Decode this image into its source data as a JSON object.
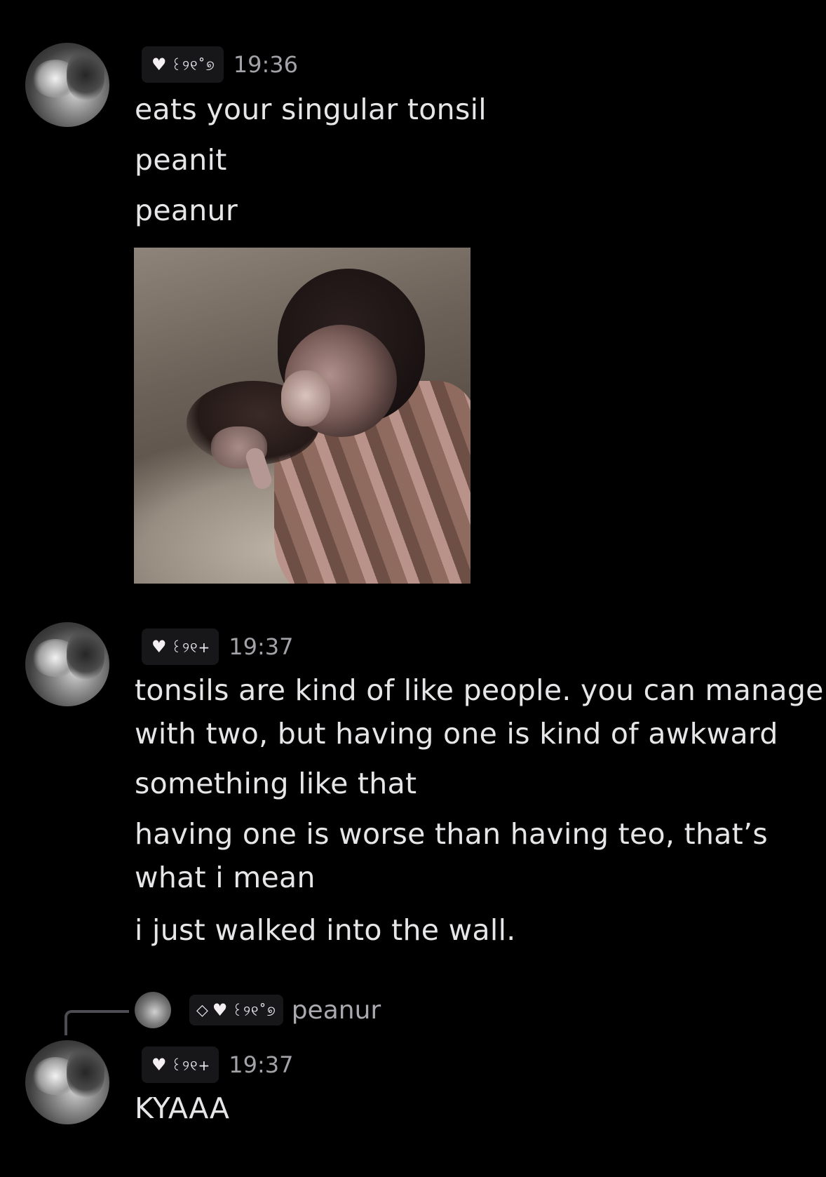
{
  "messages": [
    {
      "author": {
        "heart": "♥",
        "name": "꒰୨୧˚୭"
      },
      "timestamp": "19:36",
      "lines": [
        "eats your singular tonsil",
        "peanit",
        "peanur"
      ]
    },
    {
      "author": {
        "heart": "♥",
        "name": "꒰୨୧+"
      },
      "timestamp": "19:37",
      "lines": [
        "tonsils are kind of like people. you can manage",
        "with two, but having one is kind of awkward",
        "something like that",
        "having one is worse than having teo, that’s",
        "what i mean",
        "i just walked into the wall."
      ]
    },
    {
      "reply": {
        "diamond": "◇",
        "heart": "♥",
        "name": "꒰୨୧˚୭",
        "text": "peanur"
      },
      "author": {
        "heart": "♥",
        "name": "꒰୨୧+"
      },
      "timestamp": "19:37",
      "lines": [
        "KYAAA"
      ]
    }
  ]
}
